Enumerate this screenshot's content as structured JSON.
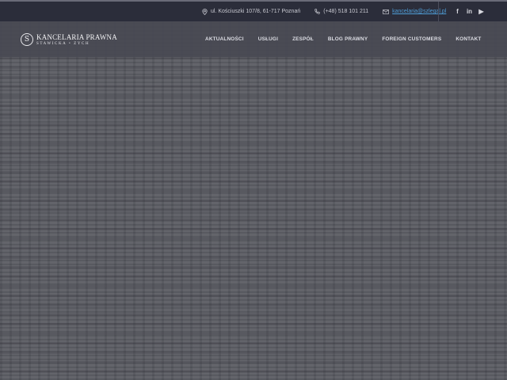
{
  "topbar": {
    "address": "ul. Kościuszki 107/8, 61-717 Poznań",
    "phone": "(+48) 518 101 211",
    "email": "kancelaria@szlegal.pl",
    "social": [
      {
        "name": "facebook-icon",
        "glyph": "f"
      },
      {
        "name": "linkedin-icon",
        "glyph": "in"
      },
      {
        "name": "youtube-icon",
        "glyph": "▶"
      }
    ]
  },
  "logo": {
    "mark": "S",
    "title": "KANCELARIA PRAWNA",
    "subtitle": "STAWICKA • ZYCH"
  },
  "menu": {
    "items": [
      {
        "label": "AKTUALNOŚCI"
      },
      {
        "label": "USŁUGI"
      },
      {
        "label": "ZESPÓŁ"
      },
      {
        "label": "BLOG PRAWNY"
      },
      {
        "label": "FOREIGN CUSTOMERS"
      },
      {
        "label": "KONTAKT"
      }
    ]
  },
  "colors": {
    "topbar_bg": "#2b2d3a",
    "navbar_bg": "#484952",
    "email_link": "#4f9ed8",
    "hero_bg": "#5a5b62"
  }
}
